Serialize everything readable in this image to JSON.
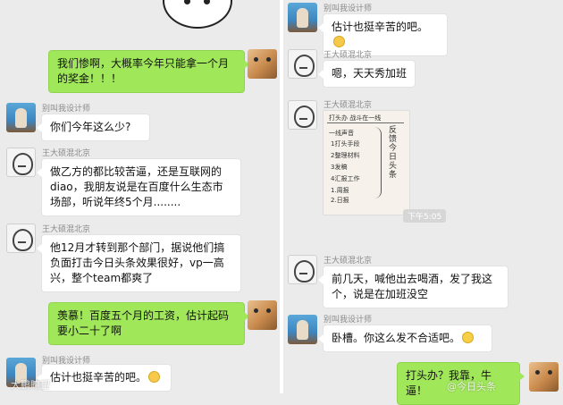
{
  "left_chat": {
    "messages": [
      {
        "sender": "me",
        "text": "我们惨啊，大概率今年只能拿一个月的奖金！！！"
      },
      {
        "sender": "别叫我设计师",
        "text": "你们今年这么少?"
      },
      {
        "sender": "王大硕混北京",
        "text": "做乙方的都比较苦逼，还是互联网的diao，我朋友说是在百度什么生态市场部，听说年终5个月........"
      },
      {
        "sender": "王大硕混北京",
        "text": "他12月才转到那个部门，据说他们搞负面打击今日头条效果很好，vp一高兴，整个team都爽了"
      },
      {
        "sender": "me",
        "text": "羡慕！百度五个月的工资，估计起码要小二十了啊"
      },
      {
        "sender": "别叫我设计师",
        "text": "估计也挺辛苦的吧。"
      }
    ],
    "watermark": "大鹏瞭望"
  },
  "right_chat": {
    "messages": [
      {
        "sender": "别叫我设计师",
        "text": "估计也挺辛苦的吧。"
      },
      {
        "sender": "王大硕混北京",
        "text": "嗯，天天秀加班"
      },
      {
        "sender": "王大硕混北京",
        "type": "image",
        "note": {
          "header": "打头办    战斗在一线",
          "lines": [
            "一线声音",
            "1打头手段",
            "2整理材料",
            "3发稿",
            "4汇报工作",
            "  1.周报",
            "  2.日报"
          ],
          "vertical": "反馈今日头条"
        }
      },
      {
        "sender": "王大硕混北京",
        "text": "前几天，喊他出去喝酒，发了我这个，说是在加班没空"
      },
      {
        "sender": "别叫我设计师",
        "text": "卧槽。你这么发不合适吧。"
      },
      {
        "sender": "me",
        "text": "打头办？我靠，牛逼！"
      }
    ],
    "timestamp": "下午5:05",
    "watermark": "@今日头条"
  }
}
